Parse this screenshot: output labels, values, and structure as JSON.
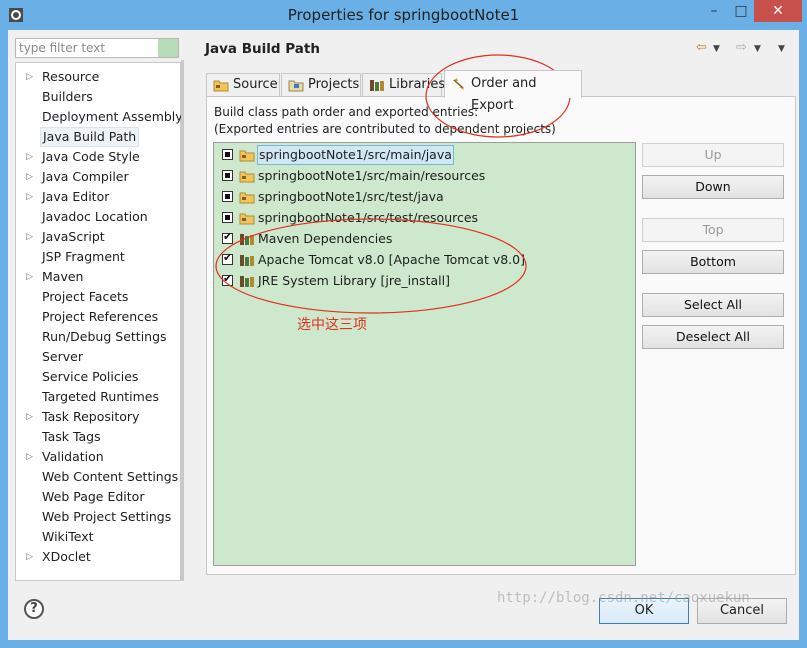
{
  "window": {
    "title": "Properties for springbootNote1",
    "controls": {
      "minimize": "–",
      "maximize": "□",
      "close": "✕"
    }
  },
  "filter": {
    "placeholder": "type filter text"
  },
  "tree": {
    "items": [
      {
        "label": "Resource",
        "expandable": true
      },
      {
        "label": "Builders",
        "expandable": false
      },
      {
        "label": "Deployment Assembly",
        "expandable": false
      },
      {
        "label": "Java Build Path",
        "expandable": false,
        "selected": true
      },
      {
        "label": "Java Code Style",
        "expandable": true
      },
      {
        "label": "Java Compiler",
        "expandable": true
      },
      {
        "label": "Java Editor",
        "expandable": true
      },
      {
        "label": "Javadoc Location",
        "expandable": false
      },
      {
        "label": "JavaScript",
        "expandable": true
      },
      {
        "label": "JSP Fragment",
        "expandable": false
      },
      {
        "label": "Maven",
        "expandable": true
      },
      {
        "label": "Project Facets",
        "expandable": false
      },
      {
        "label": "Project References",
        "expandable": false
      },
      {
        "label": "Run/Debug Settings",
        "expandable": false
      },
      {
        "label": "Server",
        "expandable": false
      },
      {
        "label": "Service Policies",
        "expandable": false
      },
      {
        "label": "Targeted Runtimes",
        "expandable": false
      },
      {
        "label": "Task Repository",
        "expandable": true
      },
      {
        "label": "Task Tags",
        "expandable": false
      },
      {
        "label": "Validation",
        "expandable": true
      },
      {
        "label": "Web Content Settings",
        "expandable": false
      },
      {
        "label": "Web Page Editor",
        "expandable": false
      },
      {
        "label": "Web Project Settings",
        "expandable": false
      },
      {
        "label": "WikiText",
        "expandable": false
      },
      {
        "label": "XDoclet",
        "expandable": true
      }
    ]
  },
  "page": {
    "title": "Java Build Path",
    "tabs": [
      {
        "label": "Source",
        "icon": "source-folder-icon"
      },
      {
        "label": "Projects",
        "icon": "projects-icon"
      },
      {
        "label": "Libraries",
        "icon": "libraries-icon"
      },
      {
        "label": "Order and Export",
        "icon": "order-export-icon",
        "active": true
      }
    ],
    "description_line1": "Build class path order and exported entries:",
    "description_line2": "(Exported entries are contributed to dependent projects)",
    "entries": [
      {
        "label": "springbootNote1/src/main/java",
        "checked": false,
        "icon": "source-folder-icon",
        "selected": true
      },
      {
        "label": "springbootNote1/src/main/resources",
        "checked": false,
        "icon": "source-folder-icon"
      },
      {
        "label": "springbootNote1/src/test/java",
        "checked": false,
        "icon": "source-folder-icon"
      },
      {
        "label": "springbootNote1/src/test/resources",
        "checked": false,
        "icon": "source-folder-icon"
      },
      {
        "label": "Maven Dependencies",
        "checked": true,
        "icon": "library-icon"
      },
      {
        "label": "Apache Tomcat v8.0 [Apache Tomcat v8.0]",
        "checked": true,
        "icon": "library-icon"
      },
      {
        "label": "JRE System Library [jre_install]",
        "checked": true,
        "icon": "library-icon"
      }
    ],
    "buttons": {
      "up": "Up",
      "down": "Down",
      "top": "Top",
      "bottom": "Bottom",
      "select_all": "Select All",
      "deselect_all": "Deselect All"
    },
    "annotation": "选中这三项"
  },
  "footer": {
    "ok": "OK",
    "cancel": "Cancel",
    "help": "?"
  },
  "watermark": "http://blog.csdn.net/caoxuekun",
  "colors": {
    "list_bg": "#cde8cd",
    "title_bar": "#6ab0e6",
    "annotation": "#e0301e",
    "close_button": "#c7504b"
  }
}
